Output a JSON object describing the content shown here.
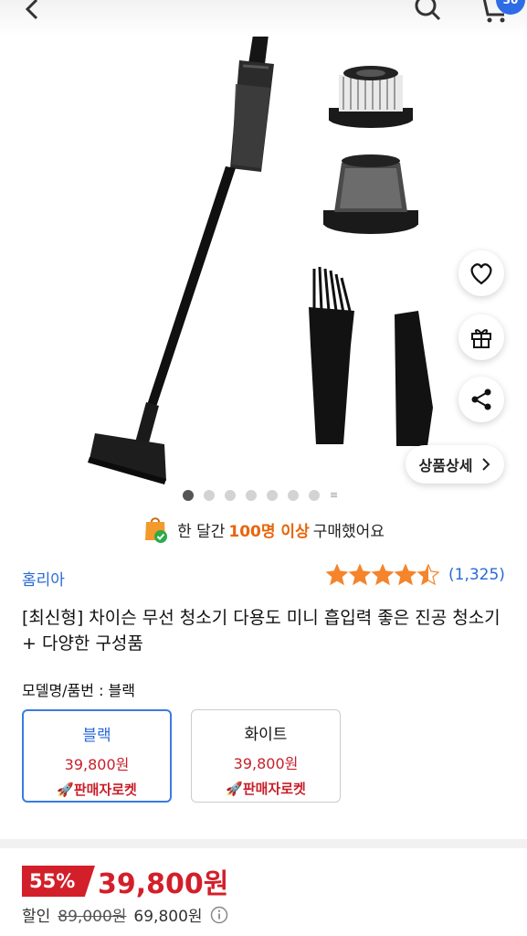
{
  "header": {
    "back_icon": "chevron-left-icon",
    "search_icon": "search-icon",
    "cart_icon": "cart-icon",
    "cart_count": "30"
  },
  "floating_buttons": {
    "wishlist_icon": "heart-icon",
    "gift_icon": "gift-icon",
    "share_icon": "share-icon",
    "detail_label": "상품상세"
  },
  "carousel": {
    "total": 7,
    "active_index": 0
  },
  "social_proof": {
    "prefix": "한 달간",
    "count": "100명 이상",
    "suffix": "구매했어요"
  },
  "seller": {
    "name": "홈리아"
  },
  "rating": {
    "stars": 4.5,
    "count": "(1,325)",
    "star_color": "#f5842b"
  },
  "product": {
    "title": "[최신형] 차이슨 무선 청소기 다용도 미니 흡입력 좋은 진공 청소기 + 다양한 구성품",
    "option_label": "모델명/품번 : 블랙"
  },
  "options": [
    {
      "name": "블랙",
      "price": "39,800원",
      "badge": "판매자로켓",
      "selected": true
    },
    {
      "name": "화이트",
      "price": "39,800원",
      "badge": "판매자로켓",
      "selected": false
    }
  ],
  "pricing": {
    "discount": "55%",
    "sale_price": "39,800원",
    "label": "할인",
    "original_price": "89,000원",
    "coupon_price": "69,800원",
    "info_icon": "info-icon"
  },
  "colors": {
    "accent": "#2a6ad8",
    "sale": "#d31f2a",
    "social_num": "#e8650a"
  }
}
